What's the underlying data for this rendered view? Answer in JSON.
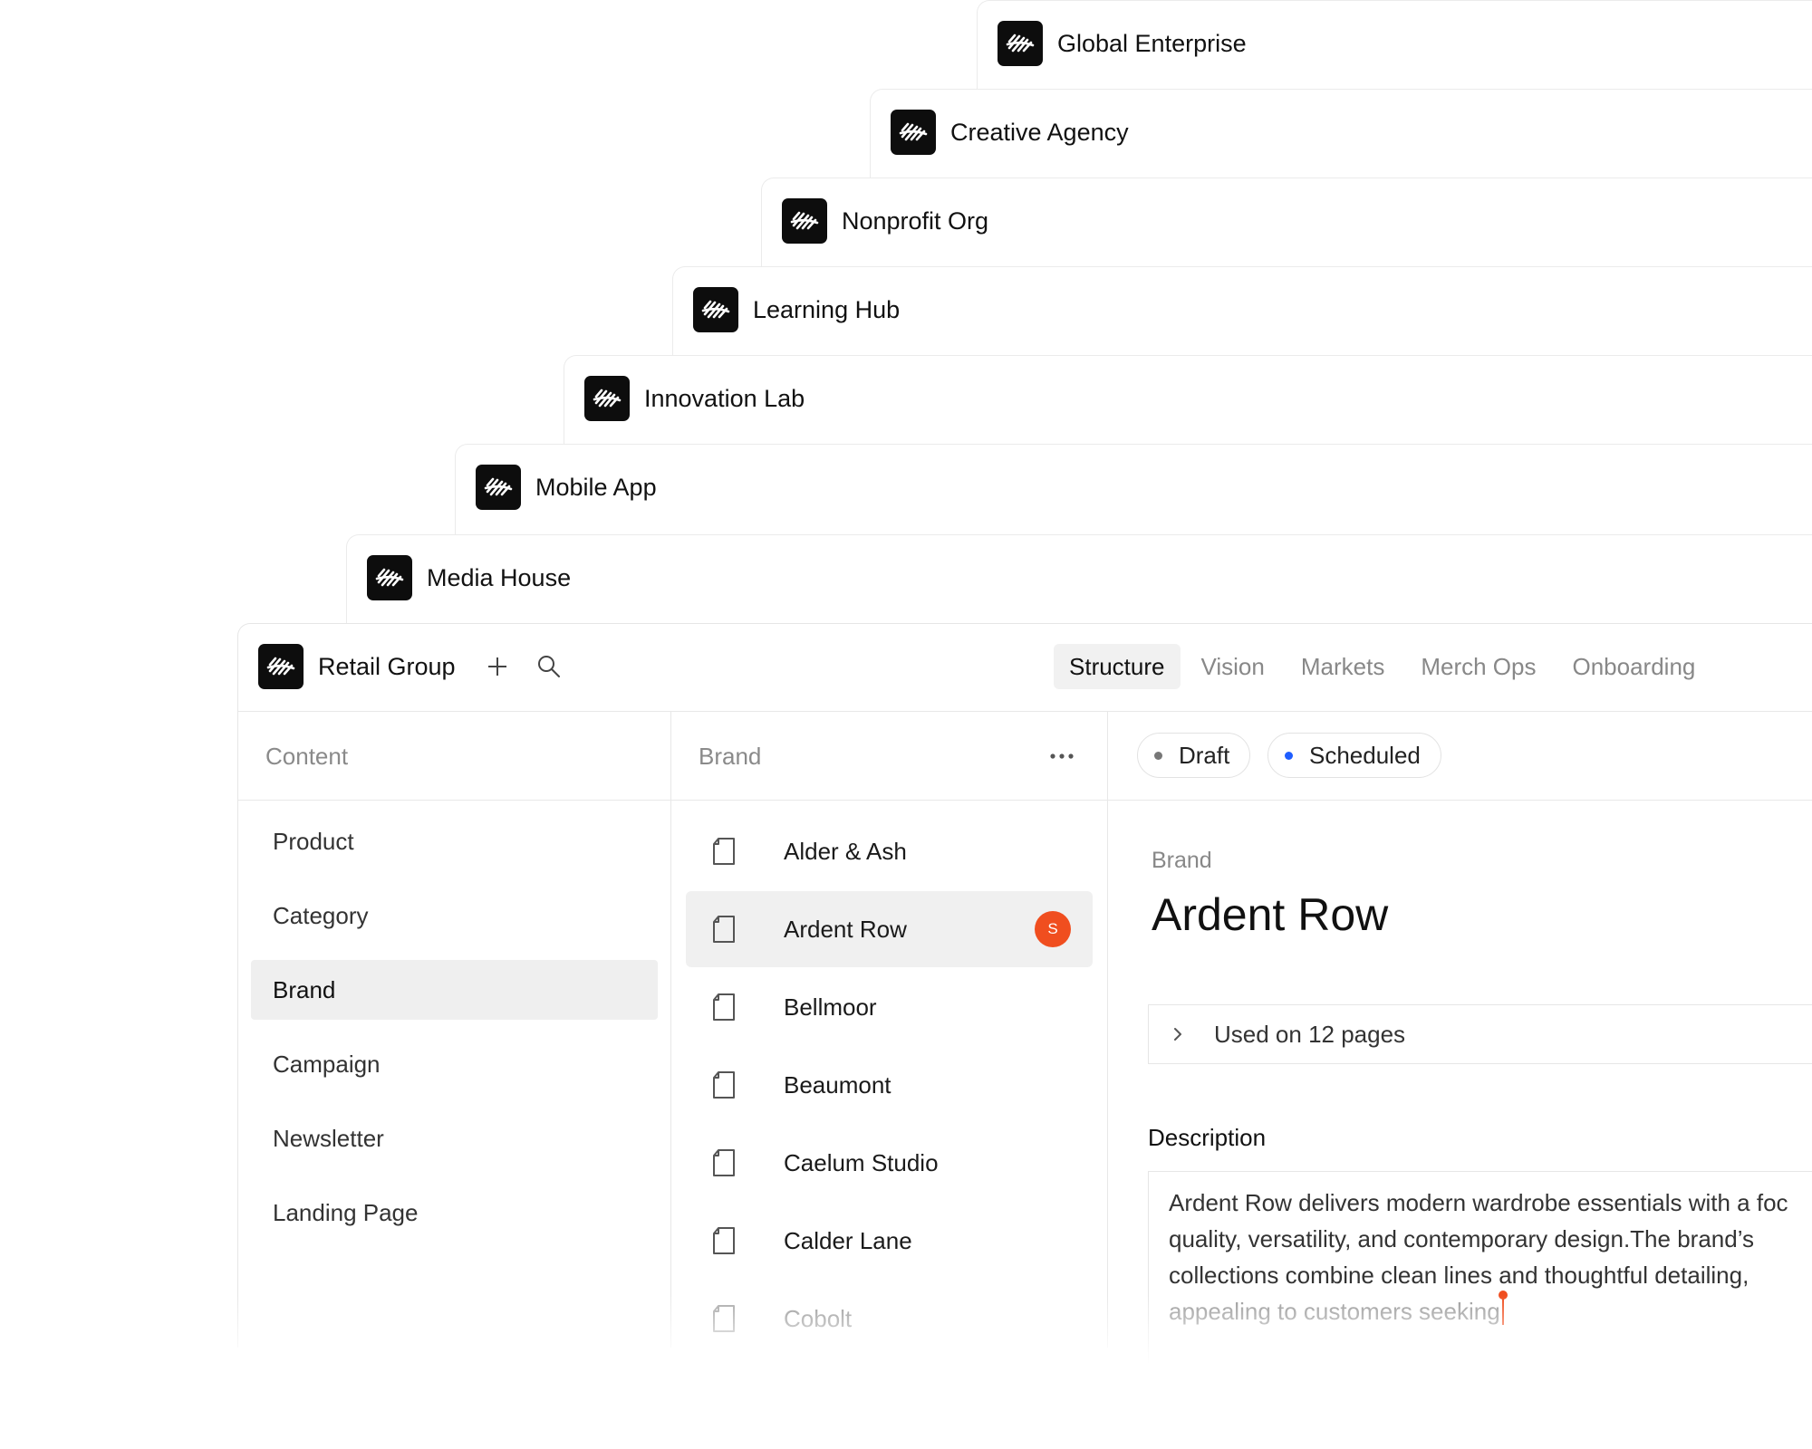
{
  "workspaces": [
    {
      "title": "Global Enterprise"
    },
    {
      "title": "Creative Agency"
    },
    {
      "title": "Nonprofit Org"
    },
    {
      "title": "Learning Hub"
    },
    {
      "title": "Innovation Lab"
    },
    {
      "title": "Mobile App"
    },
    {
      "title": "Media House"
    }
  ],
  "header": {
    "workspace": "Retail Group",
    "add_icon": "plus-icon",
    "search_icon": "search-icon",
    "tabs": [
      "Structure",
      "Vision",
      "Markets",
      "Merch Ops",
      "Onboarding"
    ],
    "active_tab": "Structure"
  },
  "content_column": {
    "heading": "Content",
    "items": [
      "Product",
      "Category",
      "Brand",
      "Campaign",
      "Newsletter",
      "Landing Page"
    ],
    "active_item": "Brand"
  },
  "brand_column": {
    "heading": "Brand",
    "menu_icon": "more-horizontal-icon",
    "items": [
      "Alder & Ash",
      "Ardent Row",
      "Bellmoor",
      "Beaumont",
      "Caelum Studio",
      "Calder Lane",
      "Cobolt"
    ],
    "active_item": "Ardent Row",
    "badge": "S"
  },
  "detail": {
    "statuses": [
      {
        "label": "Draft",
        "color": "#777777"
      },
      {
        "label": "Scheduled",
        "color": "#1f5eff"
      }
    ],
    "type_label": "Brand",
    "title": "Ardent Row",
    "used_on": "Used on 12  pages",
    "description_label": "Description",
    "description_lines": [
      "Ardent Row delivers modern wardrobe essentials with a foc",
      "quality, versatility, and contemporary design.The brand’s",
      "collections combine clean lines and thoughtful detailing,",
      "appealing to customers seeking"
    ]
  },
  "colors": {
    "accent": "#f04e1f",
    "logo_bg": "#0d0d0d",
    "active_bg": "#efefef",
    "scheduled": "#1f5eff"
  }
}
